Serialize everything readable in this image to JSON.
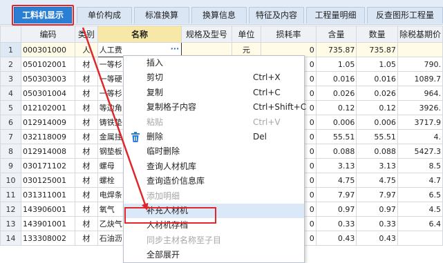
{
  "tabs": [
    {
      "label": "工料机显示",
      "active": true
    },
    {
      "label": "单价构成"
    },
    {
      "label": "标准换算"
    },
    {
      "label": "换算信息"
    },
    {
      "label": "特征及内容"
    },
    {
      "label": "工程量明细"
    },
    {
      "label": "反查图形工程量"
    }
  ],
  "columns": [
    "",
    "编码",
    "类别",
    "名称",
    "规格及型号",
    "单位",
    "损耗率",
    "含量",
    "数量",
    "除税基期价"
  ],
  "rows": [
    {
      "n": "1",
      "code": "000301000",
      "cat": "人",
      "name": "人工费",
      "spec": "",
      "unit": "元",
      "loss": "0",
      "content": "735.87",
      "qty": "735.87",
      "price": ""
    },
    {
      "n": "2",
      "code": "050102001",
      "cat": "材",
      "name": "一等杉",
      "spec": "",
      "unit": "",
      "loss": "0",
      "content": "1.05",
      "qty": "1.05",
      "price": "790."
    },
    {
      "n": "3",
      "code": "050303003",
      "cat": "材",
      "name": "一等硬",
      "spec": "",
      "unit": "",
      "loss": "0",
      "content": "0.016",
      "qty": "0.016",
      "price": "1089.7"
    },
    {
      "n": "4",
      "code": "050301004",
      "cat": "材",
      "name": "一等杉",
      "spec": "",
      "unit": "",
      "loss": "0",
      "content": "0.026",
      "qty": "0.026",
      "price": "964."
    },
    {
      "n": "5",
      "code": "012102001",
      "cat": "材",
      "name": "等边角",
      "spec": "",
      "unit": "",
      "loss": "0",
      "content": "0.12",
      "qty": "0.12",
      "price": "3926."
    },
    {
      "n": "6",
      "code": "012914009",
      "cat": "材",
      "name": "铸铁垫",
      "spec": "",
      "unit": "",
      "loss": "0",
      "content": "0.006",
      "qty": "0.006",
      "price": "3717.9"
    },
    {
      "n": "7",
      "code": "032118009",
      "cat": "材",
      "name": "金属挂",
      "spec": "",
      "unit": "",
      "loss": "0",
      "content": "55.51",
      "qty": "55.51",
      "price": "4."
    },
    {
      "n": "8",
      "code": "012914008",
      "cat": "材",
      "name": "钢垫板",
      "spec": "",
      "unit": "",
      "loss": "0",
      "content": "0.088",
      "qty": "0.088",
      "price": "5427.3"
    },
    {
      "n": "9",
      "code": "030171102",
      "cat": "材",
      "name": "螺母",
      "spec": "",
      "unit": "",
      "loss": "0",
      "content": "3.13",
      "qty": "3.13",
      "price": "8.5"
    },
    {
      "n": "10",
      "code": "030125001",
      "cat": "材",
      "name": "螺栓",
      "spec": "",
      "unit": "",
      "loss": "0",
      "content": "4.75",
      "qty": "4.75",
      "price": "4.7"
    },
    {
      "n": "11",
      "code": "031311001",
      "cat": "材",
      "name": "电焊条",
      "spec": "",
      "unit": "",
      "loss": "0",
      "content": "7.97",
      "qty": "7.97",
      "price": "6.5"
    },
    {
      "n": "12",
      "code": "143906001",
      "cat": "材",
      "name": "氧气",
      "spec": "",
      "unit": "",
      "loss": "0",
      "content": "0.97",
      "qty": "0.97",
      "price": "4.5"
    },
    {
      "n": "13",
      "code": "143901001",
      "cat": "材",
      "name": "乙炔气",
      "spec": "",
      "unit": "",
      "loss": "0",
      "content": "0.33",
      "qty": "0.33",
      "price": "6.4"
    },
    {
      "n": "14",
      "code": "133308002",
      "cat": "材",
      "name": "石油沥",
      "spec": "",
      "unit": "",
      "loss": "0",
      "content": "0.43",
      "qty": "0.43",
      "price": ""
    }
  ],
  "context_menu": [
    {
      "label": "插入",
      "shortcut": ""
    },
    {
      "label": "剪切",
      "shortcut": "Ctrl+X"
    },
    {
      "label": "复制",
      "shortcut": "Ctrl+C"
    },
    {
      "label": "复制格子内容",
      "shortcut": "Ctrl+Shift+C"
    },
    {
      "label": "粘贴",
      "shortcut": "Ctrl+V",
      "disabled": true
    },
    {
      "label": "删除",
      "shortcut": "Del",
      "icon": "trash-icon"
    },
    {
      "label": "临时删除",
      "shortcut": ""
    },
    {
      "label": "查询人材机库",
      "shortcut": ""
    },
    {
      "label": "查询造价信息库",
      "shortcut": ""
    },
    {
      "label": "添加明细",
      "shortcut": "",
      "disabled": true
    },
    {
      "label": "补充人材机",
      "shortcut": "",
      "highlighted": true
    },
    {
      "label": "人材机存档",
      "shortcut": ""
    },
    {
      "label": "同步主材名称至子目",
      "shortcut": "",
      "disabled": true
    },
    {
      "label": "全部展开",
      "shortcut": ""
    }
  ],
  "colors": {
    "accent": "#2a7fd4",
    "annotation_red": "#e0262a"
  }
}
